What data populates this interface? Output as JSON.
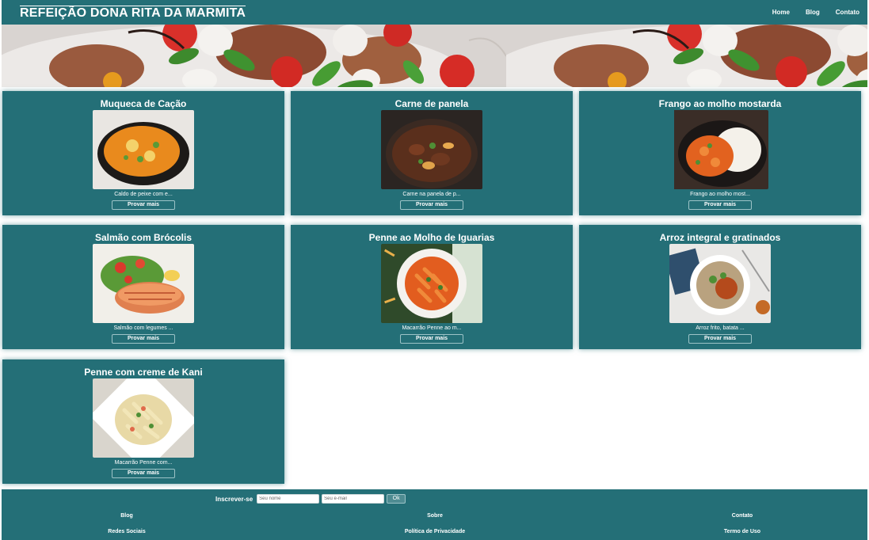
{
  "header": {
    "brand": "REFEIÇÃO DONA RITA DA MARMITA",
    "nav": [
      "Home",
      "Blog",
      "Contato"
    ]
  },
  "cards": [
    {
      "title": "Muqueca de Cação",
      "desc": "Caldo de peixe com e...",
      "button": "Provar mais"
    },
    {
      "title": "Carne de panela",
      "desc": "Carne na panela de p...",
      "button": "Provar mais"
    },
    {
      "title": "Frango ao molho mostarda",
      "desc": "Frango ao molho most...",
      "button": "Provar mais"
    },
    {
      "title": "Salmão com Brócolis",
      "desc": "Salmão com legumes ...",
      "button": "Provar mais"
    },
    {
      "title": "Penne ao Molho de Iguarias",
      "desc": "Macarrão Penne ao m...",
      "button": "Provar mais"
    },
    {
      "title": "Arroz integral e gratinados",
      "desc": "Arroz frito, batata ...",
      "button": "Provar mais"
    },
    {
      "title": "Penne com creme de Kani",
      "desc": "Macarrão Penne com...",
      "button": "Provar mais"
    }
  ],
  "footer": {
    "subscribe_label": "Inscrever-se",
    "name_placeholder": "Seu nome",
    "email_placeholder": "Seu e-mail",
    "ok_label": "Ok",
    "links": [
      "Blog",
      "Sobre",
      "Contato",
      "Redes Sociais",
      "Política de Privacidade",
      "Termo de Uso"
    ]
  },
  "colors": {
    "primary": "#246f77",
    "background": "#ffffff",
    "text": "#ffffff"
  }
}
